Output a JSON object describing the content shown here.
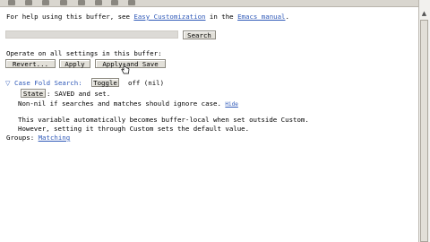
{
  "help": {
    "prefix": "For help using this buffer, see ",
    "link1": "Easy Customization",
    "middle": " in the ",
    "link2": "Emacs manual",
    "suffix": "."
  },
  "search": {
    "input_value": "",
    "button_label": "Search"
  },
  "operate": {
    "text": "Operate on all settings in this buffer:",
    "revert_label": "Revert...",
    "apply_label": "Apply",
    "apply_save_label": "Apply and Save"
  },
  "variable": {
    "name": "Case Fold Search:",
    "toggle_label": "Toggle",
    "value_text": "off (nil)",
    "state_label": "State",
    "state_text": ": SAVED and set.",
    "doc_line1": "Non-nil if searches and matches should ignore case.",
    "hide_label": "Hide",
    "note_line1": "This variable automatically becomes buffer-local when set outside Custom.",
    "note_line2": "However, setting it through Custom sets the default value.",
    "groups_label": "Groups: ",
    "groups_link": "Matching"
  },
  "colors": {
    "link": "#2f59b8",
    "button_bg": "#e2e0d9",
    "toolbar_bg": "#d9d6cf"
  }
}
